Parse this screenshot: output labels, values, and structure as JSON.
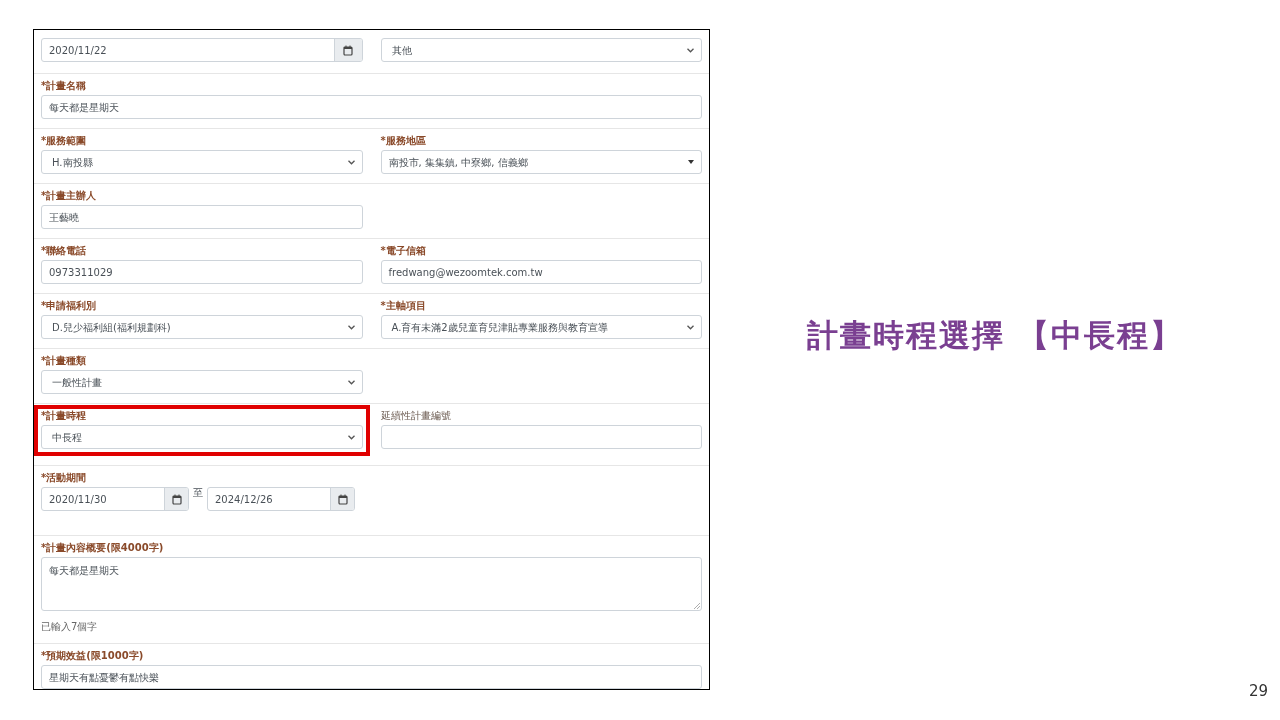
{
  "form": {
    "rows": [
      {
        "fields": [
          {
            "kind": "date",
            "value": "2020/11/22"
          },
          {
            "kind": "select",
            "value": "其他"
          }
        ]
      },
      {
        "fields": [
          {
            "kind": "text",
            "label": "*計畫名稱",
            "value": "每天都是星期天",
            "wide": true
          }
        ]
      },
      {
        "fields": [
          {
            "kind": "select",
            "label": "*服務範圍",
            "value": "H.南投縣"
          },
          {
            "kind": "dropdown",
            "label": "*服務地區",
            "value": "南投市, 集集鎮, 中寮鄉, 信義鄉"
          }
        ]
      },
      {
        "fields": [
          {
            "kind": "text",
            "label": "*計畫主辦人",
            "value": "王藝曉"
          }
        ]
      },
      {
        "fields": [
          {
            "kind": "text",
            "label": "*聯絡電話",
            "value": "0973311029"
          },
          {
            "kind": "text",
            "label": "*電子信箱",
            "value": "fredwang@wezoomtek.com.tw"
          }
        ]
      },
      {
        "fields": [
          {
            "kind": "select",
            "label": "*申請福利別",
            "value": "D.兒少福利組(福利規劃科)"
          },
          {
            "kind": "select",
            "label": "*主軸項目",
            "value": "A.育有未滿2歲兒童育兒津貼專業服務與教育宣導"
          }
        ]
      },
      {
        "fields": [
          {
            "kind": "select",
            "label": "*計畫種類",
            "value": "一般性計畫"
          }
        ]
      },
      {
        "fields": [
          {
            "kind": "select",
            "label": "*計畫時程",
            "value": "中長程",
            "highlighted": true
          },
          {
            "kind": "text",
            "label": "延續性計畫編號"
          }
        ]
      },
      {
        "fields": [
          {
            "kind": "daterange",
            "label": "*活動期間",
            "value": "2020/11/30",
            "separator": "至",
            "end_value": "2024/12/26"
          }
        ]
      },
      {
        "fields": [
          {
            "kind": "textarea",
            "label": "*計畫內容概要(限4000字)",
            "value": "每天都是星期天",
            "wide": true,
            "hint": "已輸入7個字"
          }
        ]
      },
      {
        "fields": [
          {
            "kind": "text",
            "label": "*預期效益(限1000字)",
            "value": "星期天有點憂鬱有點快樂",
            "wide": true
          }
        ]
      }
    ]
  },
  "slide": {
    "title": "計畫時程選擇 【中長程】",
    "page_number": "29"
  }
}
